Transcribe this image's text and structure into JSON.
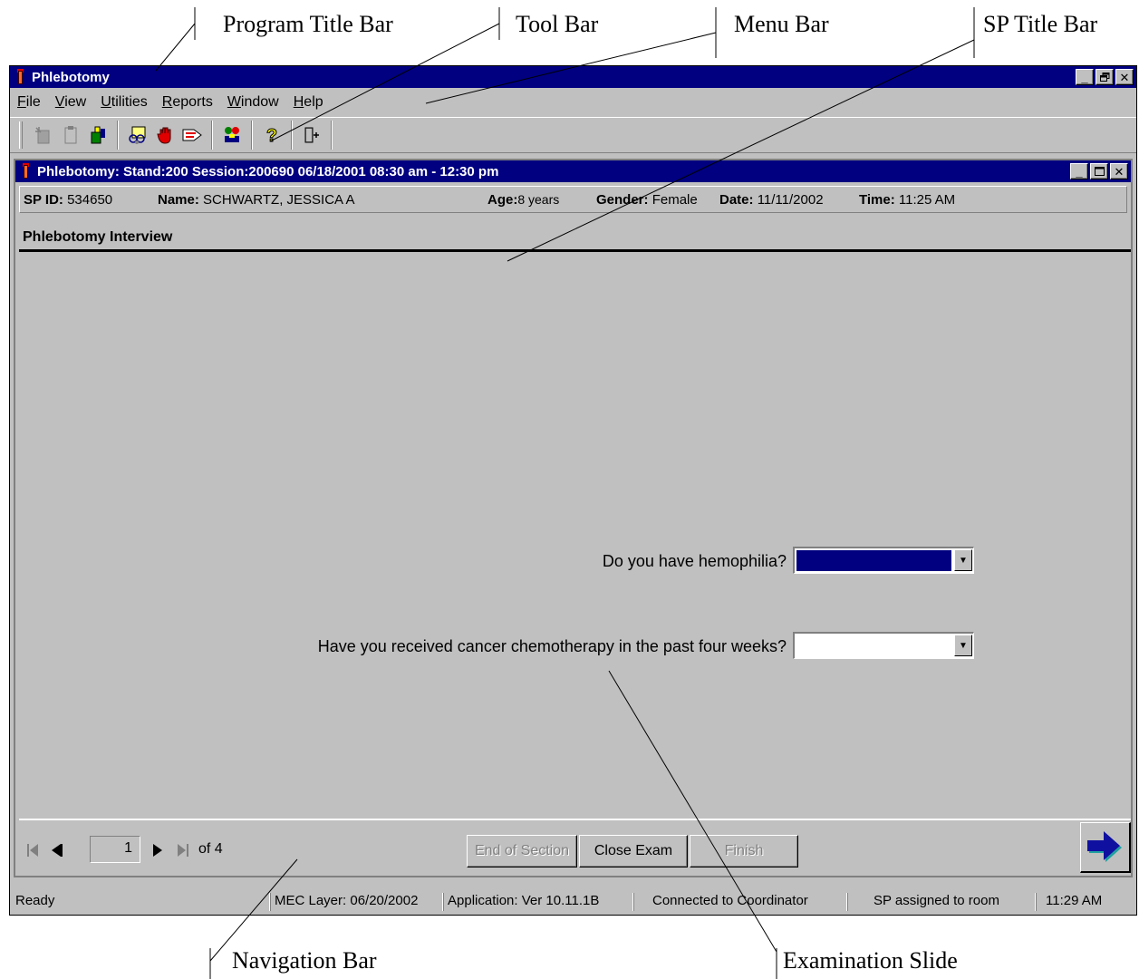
{
  "callouts": {
    "program_title_bar": "Program Title Bar",
    "tool_bar": "Tool Bar",
    "menu_bar": "Menu Bar",
    "sp_title_bar": "SP Title Bar",
    "navigation_bar": "Navigation Bar",
    "examination_slide": "Examination Slide"
  },
  "app": {
    "title": "Phlebotomy",
    "window_buttons": [
      "_",
      "⬜",
      "✕"
    ]
  },
  "menu": [
    {
      "pre": "",
      "ul": "F",
      "post": "ile"
    },
    {
      "pre": "",
      "ul": "V",
      "post": "iew"
    },
    {
      "pre": "",
      "ul": "U",
      "post": "tilities"
    },
    {
      "pre": "",
      "ul": "R",
      "post": "eports"
    },
    {
      "pre": "",
      "ul": "W",
      "post": "indow"
    },
    {
      "pre": "",
      "ul": "H",
      "post": "elp"
    }
  ],
  "toolbar": {
    "icons": [
      "new-icon",
      "clipboard-icon",
      "flask-icon",
      "people-icon",
      "stop-hand-icon",
      "tag-icon",
      "hierarchy-icon",
      "help-icon",
      "exit-door-icon"
    ]
  },
  "sp": {
    "title": "Phlebotomy: Stand:200 Session:200690 06/18/2001 08:30 am - 12:30 pm",
    "id_label": "SP ID:",
    "id_value": "534650",
    "name_label": "Name:",
    "name_value": "SCHWARTZ, JESSICA A",
    "age_label": "Age:",
    "age_value": "8 years",
    "gender_label": "Gender:",
    "gender_value": "Female",
    "date_label": "Date:",
    "date_value": "11/11/2002",
    "time_label": "Time:",
    "time_value": "11:25 AM"
  },
  "slide": {
    "title": "Phlebotomy Interview",
    "q1": "Do you have hemophilia?",
    "q2": "Have you received cancer chemotherapy in the past four weeks?"
  },
  "nav": {
    "page": "1",
    "of_label": "of 4",
    "end_of_section": "End of Section",
    "close_exam": "Close Exam",
    "finish": "Finish"
  },
  "status": {
    "ready": "Ready",
    "mec_layer": "MEC Layer: 06/20/2002",
    "application": "Application: Ver 10.11.1B",
    "connection": "Connected to Coordinator",
    "room": "SP assigned to room",
    "clock": "11:29 AM"
  }
}
